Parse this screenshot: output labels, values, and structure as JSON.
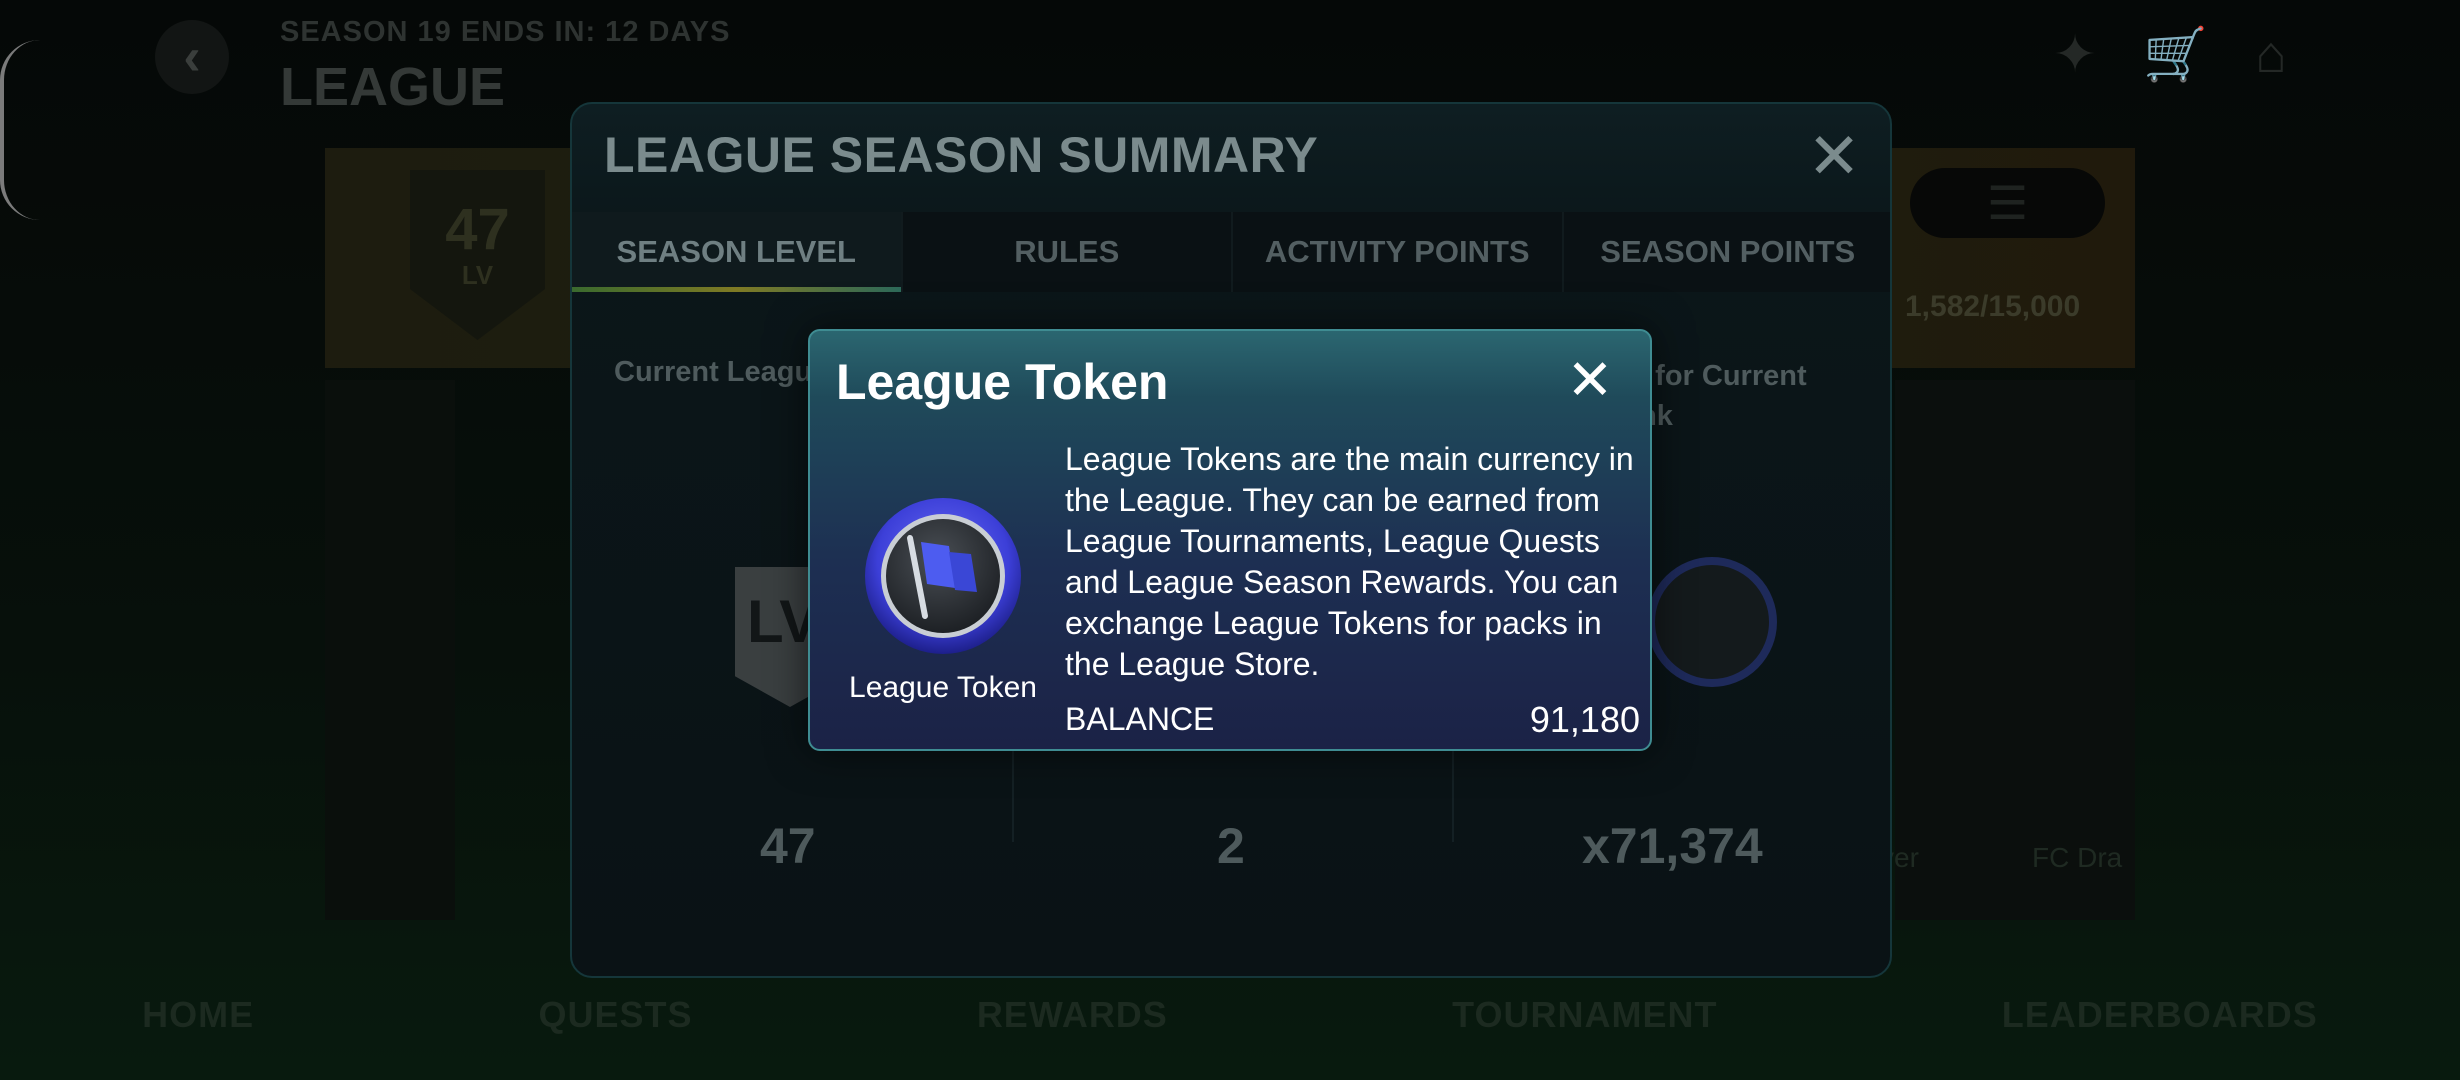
{
  "background": {
    "season_ends": "SEASON 19 ENDS IN: 12 DAYS",
    "title": "LEAGUE",
    "level_number": "47",
    "level_suffix": "LV",
    "progress": "1,582/15,000",
    "card_texts": [
      "ver",
      "FC Dra"
    ],
    "nav": [
      "HOME",
      "QUESTS",
      "REWARDS",
      "TOURNAMENT",
      "LEADERBOARDS"
    ]
  },
  "summary_panel": {
    "title": "LEAGUE SEASON SUMMARY",
    "tabs": [
      "SEASON LEVEL",
      "RULES",
      "ACTIVITY POINTS",
      "SEASON POINTS"
    ],
    "active_tab": 0,
    "current_label": "Current League",
    "reward_label_line1": "ard for Current",
    "reward_label_line2": "Rank",
    "level_value": "47",
    "rank_value": "2",
    "token_reward": "x71,374",
    "lv_badge_text": "LV"
  },
  "dialog": {
    "title": "League Token",
    "icon": "league-flag-token-icon",
    "icon_caption": "League Token",
    "description": "League Tokens are the main currency in the League. They can be earned from League Tournaments, League Quests and League Season Rewards. You can exchange League Tokens for packs in the League Store.",
    "balance_label": "BALANCE",
    "balance_value": "91,180"
  },
  "colors": {
    "dialog_border": "#3f8c92",
    "dialog_top": "#2b6670",
    "dialog_bottom": "#1b2246",
    "token_ring": "#3c3fd8"
  }
}
